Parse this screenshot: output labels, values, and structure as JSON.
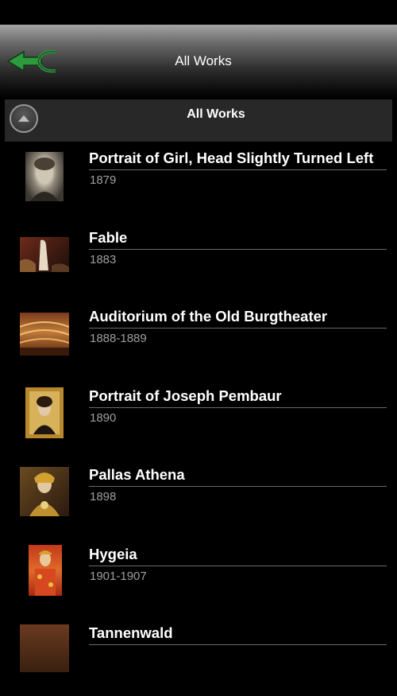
{
  "header": {
    "title": "All Works",
    "back_icon": "back-arrow-icon"
  },
  "section": {
    "title": "All Works",
    "collapse_icon": "chevron-up-icon"
  },
  "works": [
    {
      "title": "Portrait of Girl, Head Slightly Turned Left",
      "date": "1879"
    },
    {
      "title": "Fable",
      "date": "1883"
    },
    {
      "title": "Auditorium of the Old Burgtheater",
      "date": "1888-1889"
    },
    {
      "title": "Portrait of Joseph Pembaur",
      "date": "1890"
    },
    {
      "title": "Pallas Athena",
      "date": "1898"
    },
    {
      "title": "Hygeia",
      "date": "1901-1907"
    },
    {
      "title": "Tannenwald",
      "date": ""
    }
  ],
  "colors": {
    "accent_green": "#2e9a3e",
    "list_background": "#000000",
    "divider": "#6a6a6a"
  }
}
